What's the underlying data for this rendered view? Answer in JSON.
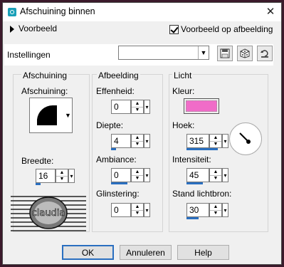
{
  "window": {
    "title": "Afschuining binnen",
    "close_glyph": "✕"
  },
  "preview": {
    "label": "Voorbeeld",
    "on_image_label": "Voorbeeld op afbeelding",
    "on_image_checked": true
  },
  "settings": {
    "label": "Instellingen",
    "value": ""
  },
  "bevel": {
    "group_label": "Afschuining",
    "bevel_label": "Afschuining:",
    "width_label": "Breedte:",
    "width_value": "16",
    "width_fraction": 0.16
  },
  "image": {
    "group_label": "Afbeelding",
    "smoothness_label": "Effenheid:",
    "smoothness_value": "0",
    "smoothness_fraction": 0,
    "depth_label": "Diepte:",
    "depth_value": "4",
    "depth_fraction": 0.16,
    "ambience_label": "Ambiance:",
    "ambience_value": "0",
    "ambience_fraction": 0.5,
    "shininess_label": "Glinstering:",
    "shininess_value": "0",
    "shininess_fraction": 0
  },
  "light": {
    "group_label": "Licht",
    "color_label": "Kleur:",
    "color": "#f06cc8",
    "angle_label": "Hoek:",
    "angle_value": "315",
    "angle_fraction": 0.875,
    "intensity_label": "Intensiteit:",
    "intensity_value": "45",
    "intensity_fraction": 0.45,
    "elevation_label": "Stand lichtbron:",
    "elevation_value": "30",
    "elevation_fraction": 0.33
  },
  "logo": {
    "text": "claudia"
  },
  "buttons": {
    "ok": "OK",
    "cancel": "Annuleren",
    "help": "Help"
  },
  "colors": {
    "accent": "#2a6fc0",
    "frame": "#3b1a2b"
  }
}
